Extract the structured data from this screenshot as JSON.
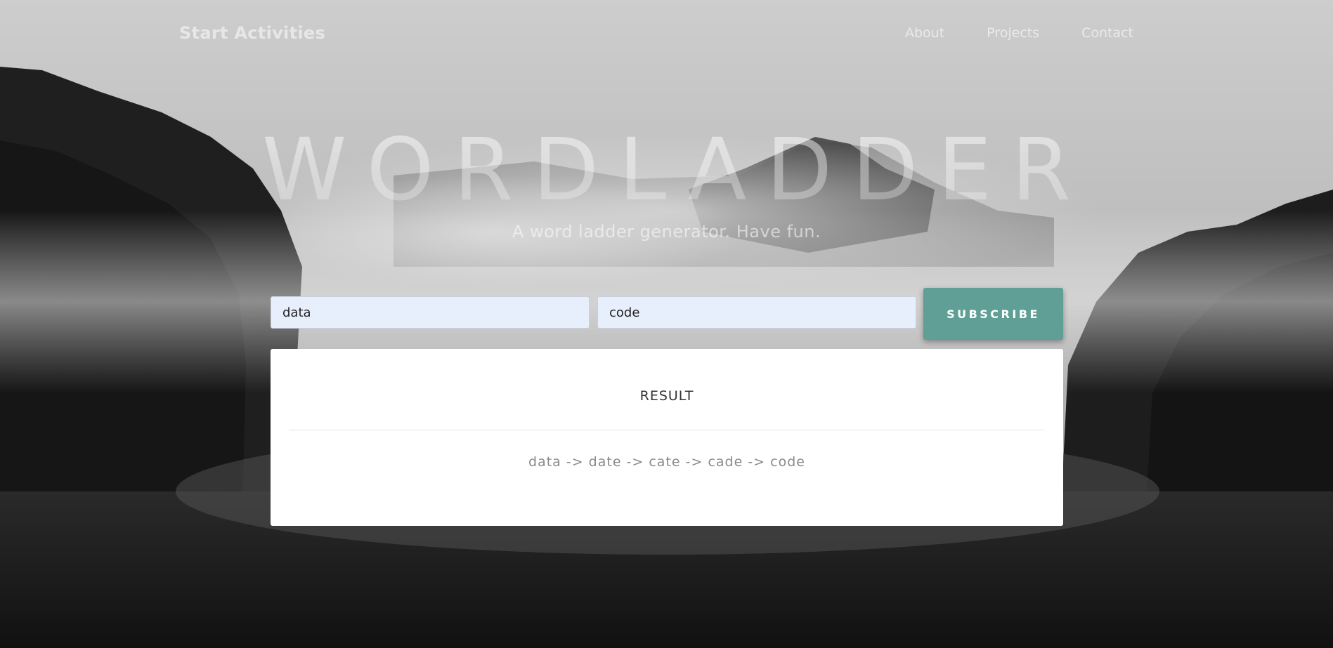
{
  "navbar": {
    "brand": "Start Activities",
    "links": [
      "About",
      "Projects",
      "Contact"
    ]
  },
  "hero": {
    "title": "WORDLADDER",
    "subtitle": "A word ladder generator. Have fun."
  },
  "form": {
    "start_word_value": "data",
    "end_word_value": "code",
    "submit_label": "SUBSCRIBE"
  },
  "result": {
    "title": "RESULT",
    "ladder": "data -> date -> cate -> cade -> code"
  },
  "colors": {
    "button": "#5f9f95",
    "input_background": "#e8effc",
    "card_background": "#ffffff"
  }
}
